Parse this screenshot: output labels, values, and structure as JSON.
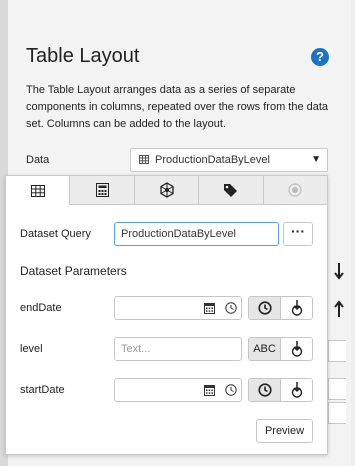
{
  "panel": {
    "title": "Table Layout",
    "help_icon": "help-icon",
    "description": "The Table Layout arranges data as a series of separate components in columns, repeated over the rows from the data set. Columns can be added to the layout.",
    "data_label": "Data",
    "data_value": "ProductionDataByLevel"
  },
  "popup": {
    "tabs": [
      {
        "icon": "table-icon",
        "active": true
      },
      {
        "icon": "calculator-icon",
        "active": false
      },
      {
        "icon": "network-icon",
        "active": false
      },
      {
        "icon": "tag-icon",
        "active": false
      },
      {
        "icon": "target-icon",
        "active": false
      }
    ],
    "dataset_query_label": "Dataset Query",
    "dataset_query_value": "ProductionDataByLevel",
    "dots_label": "···",
    "parameters_heading": "Dataset Parameters",
    "params": [
      {
        "label": "endDate",
        "value": "",
        "placeholder": ""
      },
      {
        "label": "level",
        "value": "",
        "placeholder": "Text..."
      },
      {
        "label": "startDate",
        "value": "",
        "placeholder": ""
      }
    ],
    "abc_label": "ABC",
    "preview_label": "Preview"
  },
  "colors": {
    "accent": "#1e73be",
    "focus_border": "#5aa0d8"
  }
}
